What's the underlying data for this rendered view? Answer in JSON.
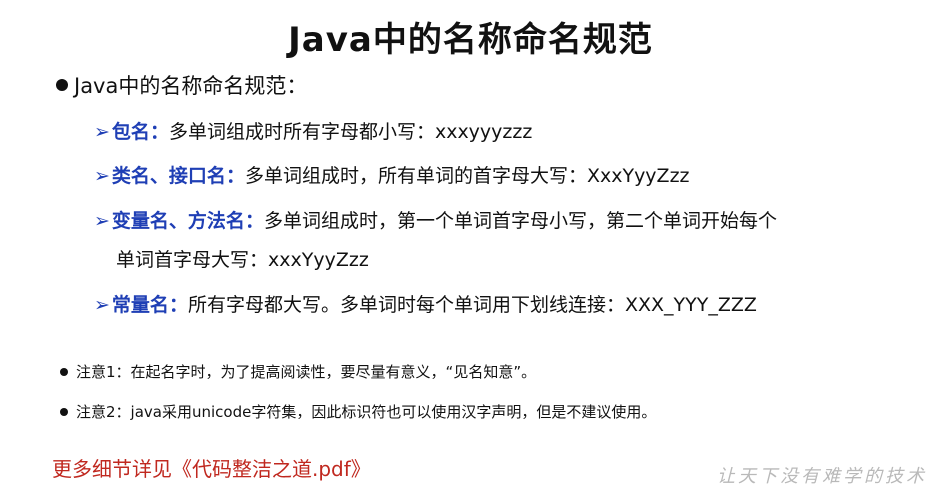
{
  "title": "Java中的名称命名规范",
  "main_bullet": "Java中的名称命名规范：",
  "items": [
    {
      "arrow": "➢",
      "term": "包名",
      "sep": "：",
      "text": "多单词组成时所有字母都小写：xxxyyyzzz"
    },
    {
      "arrow": "➢",
      "term": "类名、接口名",
      "sep": "：",
      "text": "多单词组成时，所有单词的首字母大写：XxxYyyZzz"
    },
    {
      "arrow": "➢",
      "term": "变量名、方法名",
      "sep": "：",
      "text": "多单词组成时，第一个单词首字母小写，第二个单词开始每个",
      "continuation": "单词首字母大写：xxxYyyZzz"
    },
    {
      "arrow": "➢",
      "term": "常量名",
      "sep": "：",
      "text": "所有字母都大写。多单词时每个单词用下划线连接：XXX_YYY_ZZZ"
    }
  ],
  "notes": [
    "注意1：在起名字时，为了提高阅读性，要尽量有意义，“见名知意”。",
    "注意2：java采用unicode字符集，因此标识符也可以使用汉字声明，但是不建议使用。"
  ],
  "more_details": "更多细节详见《代码整洁之道.pdf》",
  "watermark": "让天下没有难学的技术",
  "colors": {
    "term_blue": "#1f3fb5",
    "link_red": "#c0281f"
  }
}
